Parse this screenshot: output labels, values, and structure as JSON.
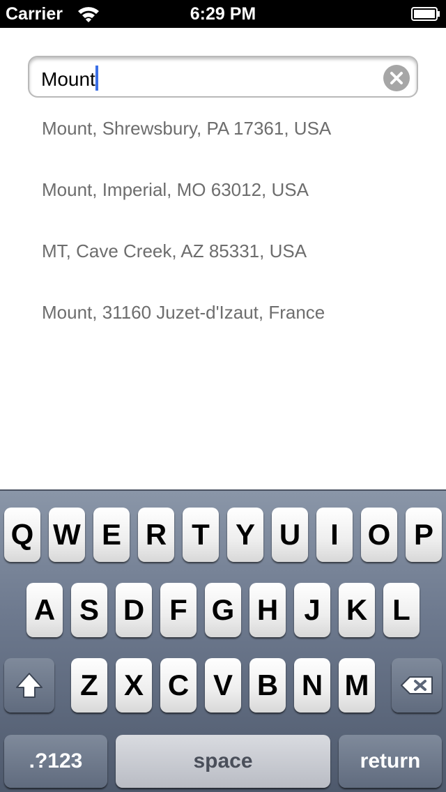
{
  "status_bar": {
    "carrier": "Carrier",
    "time": "6:29 PM",
    "wifi_icon": "wifi-icon",
    "battery_icon": "battery-icon"
  },
  "search": {
    "value": "Mount",
    "clear_icon": "clear-icon"
  },
  "suggestions": [
    "Mount, Shrewsbury, PA 17361, USA",
    "Mount, Imperial, MO 63012, USA",
    "MT, Cave Creek, AZ 85331, USA",
    "Mount, 31160 Juzet-d'Izaut, France"
  ],
  "keyboard": {
    "row1": [
      "Q",
      "W",
      "E",
      "R",
      "T",
      "Y",
      "U",
      "I",
      "O",
      "P"
    ],
    "row2": [
      "A",
      "S",
      "D",
      "F",
      "G",
      "H",
      "J",
      "K",
      "L"
    ],
    "row3": [
      "Z",
      "X",
      "C",
      "V",
      "B",
      "N",
      "M"
    ],
    "shift_icon": "shift-icon",
    "delete_icon": "backspace-icon",
    "numbers_label": ".?123",
    "space_label": "space",
    "return_label": "return"
  },
  "colors": {
    "cursor": "#3b6fe6",
    "suggestion_text": "#6d6d6d",
    "keyboard_background": "#6e7a8f"
  }
}
